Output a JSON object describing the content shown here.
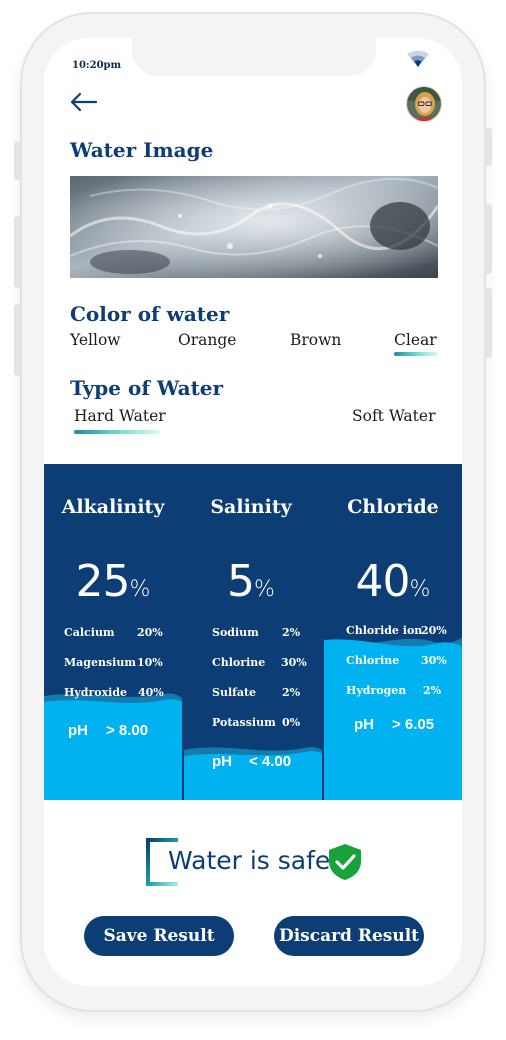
{
  "status_bar": {
    "time": "10:20pm"
  },
  "header": {
    "back_icon": "arrow-left-icon",
    "avatar_icon": "user-avatar"
  },
  "water_image": {
    "title": "Water Image"
  },
  "color_of_water": {
    "title": "Color of water",
    "options": [
      "Yellow",
      "Orange",
      "Brown",
      "Clear"
    ],
    "selected": "Clear"
  },
  "type_of_water": {
    "title": "Type of Water",
    "options": [
      "Hard Water",
      "Soft Water"
    ],
    "selected": "Hard Water"
  },
  "results": [
    {
      "title": "Alkalinity",
      "percent": "25",
      "percent_sign": "%",
      "rows": [
        {
          "label": "Calcium",
          "value": "20%"
        },
        {
          "label": "Magensium",
          "value": "10%"
        },
        {
          "label": "Hydroxide",
          "value": "40%"
        }
      ],
      "ph_label": "pH",
      "ph_value": "> 8.00"
    },
    {
      "title": "Salinity",
      "percent": "5",
      "percent_sign": "%",
      "rows": [
        {
          "label": "Sodium",
          "value": "2%"
        },
        {
          "label": "Chlorine",
          "value": "30%"
        },
        {
          "label": "Sulfate",
          "value": "2%"
        },
        {
          "label": "Potassium",
          "value": "0%"
        }
      ],
      "ph_label": "pH",
      "ph_value": "< 4.00"
    },
    {
      "title": "Chloride",
      "percent": "40",
      "percent_sign": "%",
      "rows": [
        {
          "label": "Chloride ion",
          "value": "20%"
        },
        {
          "label": "Chlorine",
          "value": "30%"
        },
        {
          "label": "Hydrogen",
          "value": "2%"
        }
      ],
      "ph_label": "pH",
      "ph_value": "> 6.05"
    }
  ],
  "safety": {
    "text": "Water is safe",
    "icon": "shield-check-icon"
  },
  "actions": {
    "save_label": "Save Result",
    "discard_label": "Discard Result"
  },
  "colors": {
    "primary": "#0c3d75",
    "accent_blue": "#00b2f0",
    "accent_gradient_start": "#1690a6",
    "accent_gradient_end": "#7fe6d4",
    "safe_green": "#17a23a"
  }
}
